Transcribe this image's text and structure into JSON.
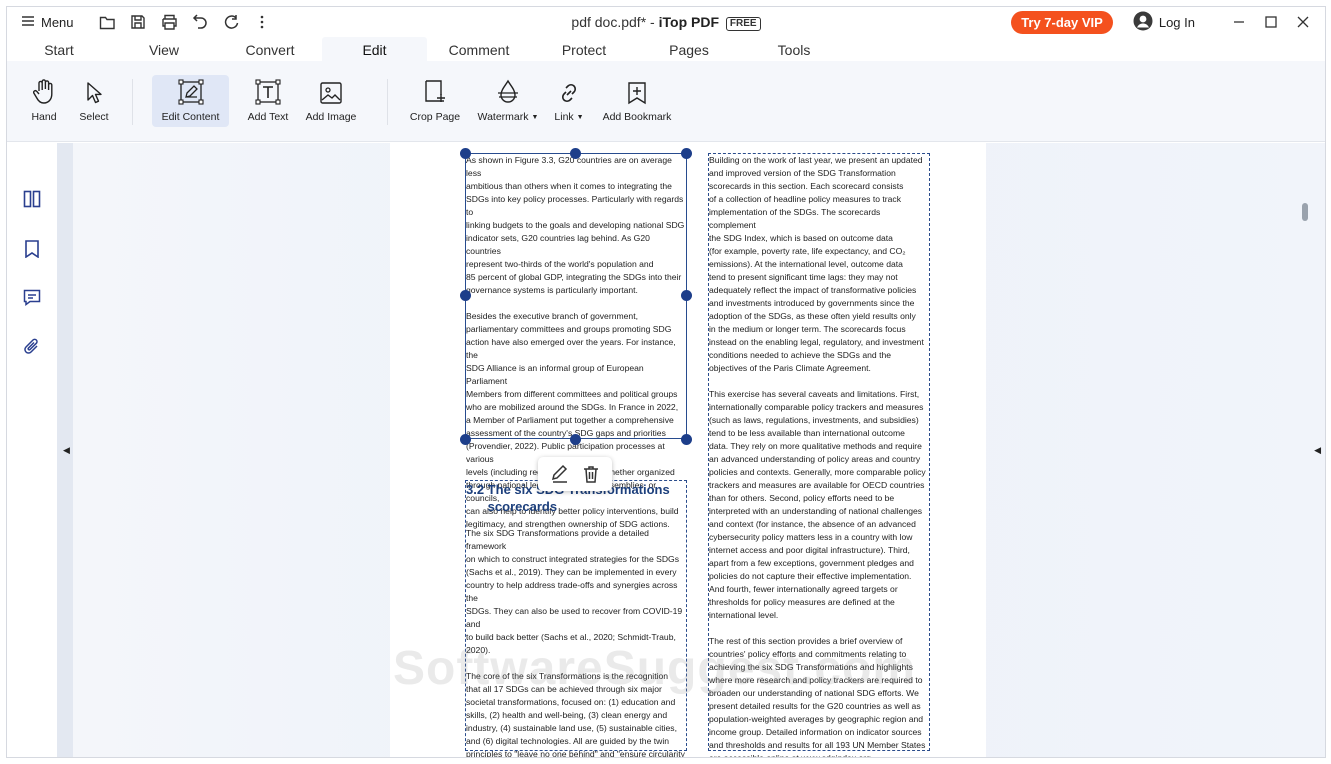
{
  "titlebar": {
    "menu_label": "Menu",
    "doc_name": "pdf doc.pdf*",
    "separator": " - ",
    "app_name": "iTop PDF",
    "badge": "FREE",
    "vip_label": "Try 7-day VIP",
    "login_label": "Log In",
    "icons": [
      "menu-icon",
      "open-folder-icon",
      "save-icon",
      "print-icon",
      "undo-icon",
      "redo-icon",
      "more-icon"
    ]
  },
  "tabs": [
    "Start",
    "View",
    "Convert",
    "Edit",
    "Comment",
    "Protect",
    "Pages",
    "Tools"
  ],
  "active_tab": "Edit",
  "ribbon": {
    "hand": "Hand",
    "select": "Select",
    "edit_content": "Edit Content",
    "add_text": "Add Text",
    "add_image": "Add Image",
    "crop_page": "Crop Page",
    "watermark": "Watermark",
    "link": "Link",
    "add_bookmark": "Add Bookmark"
  },
  "sidebar": {
    "icons": [
      "thumbnails-icon",
      "bookmark-icon",
      "comment-icon",
      "attachment-icon"
    ]
  },
  "document": {
    "left_block1": {
      "p1": "As shown in Figure 3.3, G20 countries are on average less\nambitious than others when it comes to integrating the\nSDGs into key policy processes. Particularly with regards to\nlinking budgets to the goals and developing national SDG\nindicator sets, G20 countries lag behind. As G20 countries\nrepresent two-thirds of the world's population and\n85 percent of global GDP, integrating the SDGs into their\ngovernance systems is particularly important.",
      "p2": "Besides the executive branch of government,\nparliamentary committees and groups promoting SDG\naction have also emerged over the years. For instance, the\nSDG Alliance is an informal group of European Parliament\nMembers from different committees and political groups\nwho are mobilized around the SDGs. In France in 2022,\na Member of Parliament put together a comprehensive\nassessment of the country's SDG gaps and priorities\n(Provendier, 2022). Public participation processes at various\nlevels (including regions and cities), whether organized\nthrough national legislature, citizen assemblies, or councils,\ncan also help to identify better policy interventions, build\nlegitimacy, and strengthen ownership of SDG actions."
    },
    "heading": "3.2 The six SDG Transformations\n      scorecards",
    "left_block2": {
      "p1": "The six SDG Transformations provide a detailed framework\non which to construct integrated strategies for the SDGs\n(Sachs et al., 2019). They can be implemented in every\ncountry to help address trade-offs and synergies across the\nSDGs. They can also be used to recover from COVID-19 and\nto build back better (Sachs et al., 2020; Schmidt-Traub, 2020).",
      "p2": "The core of the six Transformations is the recognition\nthat all 17 SDGs can be achieved through six major\nsocietal transformations, focused on: (1) education and\nskills, (2) health and well-being, (3) clean energy and\nindustry, (4) sustainable land use, (5) sustainable cities,\nand (6) digital technologies. All are guided by the twin\nprinciples to \"leave no one behind\" and \"ensure circularity\nand decoupling\" (see Sachs et al., 2019 for details, page\n3). The six Transformations provide an action agenda for\ngovernment ministries, businesses, and civil society."
    },
    "right_block": {
      "p1": "Building on the work of last year, we present an updated\nand improved version of the SDG Transformation\nscorecards in this section. Each scorecard consists\nof a collection of headline policy measures to track\nimplementation of the SDGs. The scorecards complement\nthe SDG Index, which is based on outcome data\n(for example, poverty rate, life expectancy, and CO₂\nemissions). At the international level, outcome data\ntend to present significant time lags: they may not\nadequately reflect the impact of transformative policies\nand investments introduced by governments since the\nadoption of the SDGs, as these often yield results only\nin the medium or longer term. The scorecards focus\ninstead on the enabling legal, regulatory, and investment\nconditions needed to achieve the SDGs and the\nobjectives of the Paris Climate Agreement.",
      "p2": "This exercise has several caveats and limitations. First,\ninternationally comparable policy trackers and measures\n(such as laws, regulations, investments, and subsidies)\ntend to be less available than international outcome\ndata. They rely on more qualitative methods and require\nan advanced understanding of policy areas and country\npolicies and contexts. Generally, more comparable policy\ntrackers and measures are available for OECD countries\nthan for others. Second, policy efforts need to be\ninterpreted with an understanding of national challenges\nand context (for instance, the absence of an advanced\ncybersecurity policy matters less in a country with low\ninternet access and poor digital infrastructure). Third,\napart from a few exceptions, government pledges and\npolicies do not capture their effective implementation.\nAnd fourth, fewer internationally agreed targets or\nthresholds for policy measures are defined at the\ninternational level.",
      "p3": "The rest of this section provides a brief overview of\ncountries' policy efforts and commitments relating to\nachieving the six SDG Transformations and highlights\nwhere more research and policy trackers are required to\nbroaden our understanding of national SDG efforts. We\npresent detailed results for the G20 countries as well as\npopulation-weighted averages by geographic region and\nincome group. Detailed information on indicator sources\nand thresholds and results for all 193 UN Member States\nare accessible online at www.sdgindex.org."
    },
    "watermark": "SoftwareSuggest.com"
  },
  "colors": {
    "accent": "#1d3e8a",
    "vip": "#f4511e",
    "ribbon_bg": "#f5f7fb",
    "active_tool_bg": "#e0e7f6"
  }
}
